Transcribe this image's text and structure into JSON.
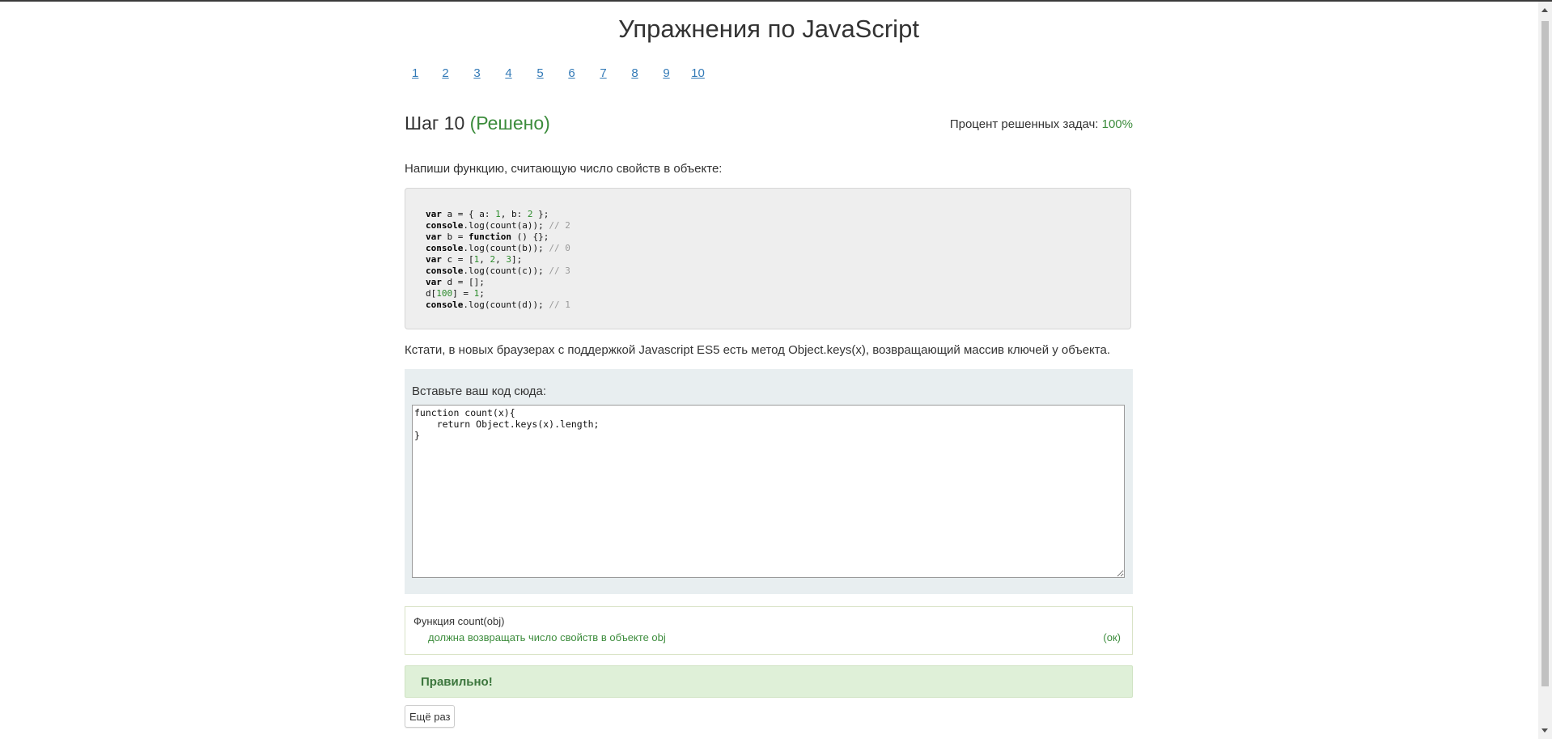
{
  "header": {
    "title": "Упражнения по JavaScript"
  },
  "steps": [
    "1",
    "2",
    "3",
    "4",
    "5",
    "6",
    "7",
    "8",
    "9",
    "10"
  ],
  "step": {
    "label": "Шаг 10",
    "status": "(Решено)",
    "percent_label": "Процент решенных задач:",
    "percent_value": "100%"
  },
  "task": {
    "description": "Напиши функцию, считающую число свойств в объекте:",
    "hint": "Кстати, в новых браузерах с поддержкой Javascript ES5 есть метод Object.keys(x), возвращающий массив ключей у объекта.",
    "code_lines": [
      "var a = { a: 1, b: 2 };",
      "console.log(count(a)); // 2",
      "var b = function () {};",
      "console.log(count(b)); // 0",
      "var c = [1, 2, 3];",
      "console.log(count(c)); // 3",
      "var d = [];",
      "d[100] = 1;",
      "console.log(count(d)); // 1"
    ]
  },
  "editor": {
    "label": "Вставьте ваш код сюда:",
    "value": "function count(x){\n    return Object.keys(x).length;\n}"
  },
  "tests": {
    "function_name": "Функция count(obj)",
    "case": "должна возвращать число свойств в объекте obj",
    "status": "(ок)"
  },
  "result": {
    "message": "Правильно!"
  },
  "actions": {
    "retry_label": "Ещё раз"
  },
  "colors": {
    "link": "#337ab7",
    "success": "#3c8c3c",
    "success_bg": "#dff0d8"
  }
}
